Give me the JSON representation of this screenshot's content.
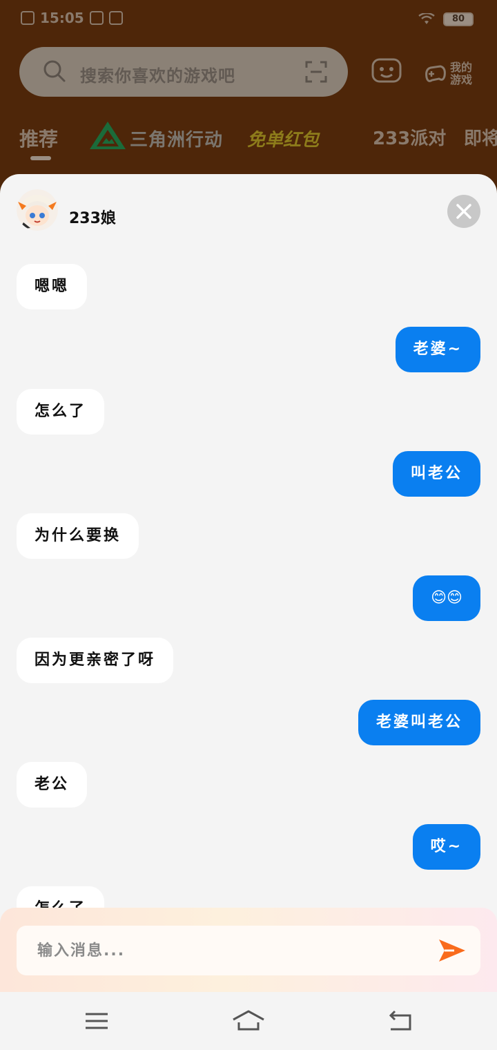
{
  "status_bar": {
    "time": "15:05",
    "battery": "80"
  },
  "background_app": {
    "search_placeholder": "搜索你喜欢的游戏吧",
    "my_games_label_line1": "我的",
    "my_games_label_line2": "游戏",
    "tabs": [
      {
        "label": "推荐"
      },
      {
        "label": "三角洲行动"
      },
      {
        "label": "免单红包"
      },
      {
        "label": "233派对"
      },
      {
        "label": "即将"
      }
    ]
  },
  "chat": {
    "bot_name": "233娘",
    "messages": [
      {
        "sender": "bot",
        "text": "嗯嗯"
      },
      {
        "sender": "me",
        "text": "老婆~"
      },
      {
        "sender": "bot",
        "text": "怎么了"
      },
      {
        "sender": "me",
        "text": "叫老公"
      },
      {
        "sender": "bot",
        "text": "为什么要换"
      },
      {
        "sender": "me",
        "text": "😊😊"
      },
      {
        "sender": "bot",
        "text": "因为更亲密了呀"
      },
      {
        "sender": "me",
        "text": "老婆叫老公"
      },
      {
        "sender": "bot",
        "text": "老公"
      },
      {
        "sender": "me",
        "text": "哎~"
      },
      {
        "sender": "bot",
        "text": "怎么了"
      }
    ],
    "input_placeholder": "输入消息...",
    "colors": {
      "my_bubble": "#0a7ff0",
      "bot_bubble": "#ffffff",
      "send_icon": "#f96b1c"
    }
  },
  "icons": {
    "search": "search-icon",
    "scan": "scan-icon",
    "chat": "chat-icon",
    "gamepad": "gamepad-icon",
    "close": "close-icon",
    "send": "send-icon",
    "menu": "menu-icon",
    "home": "home-icon",
    "back": "back-icon"
  }
}
